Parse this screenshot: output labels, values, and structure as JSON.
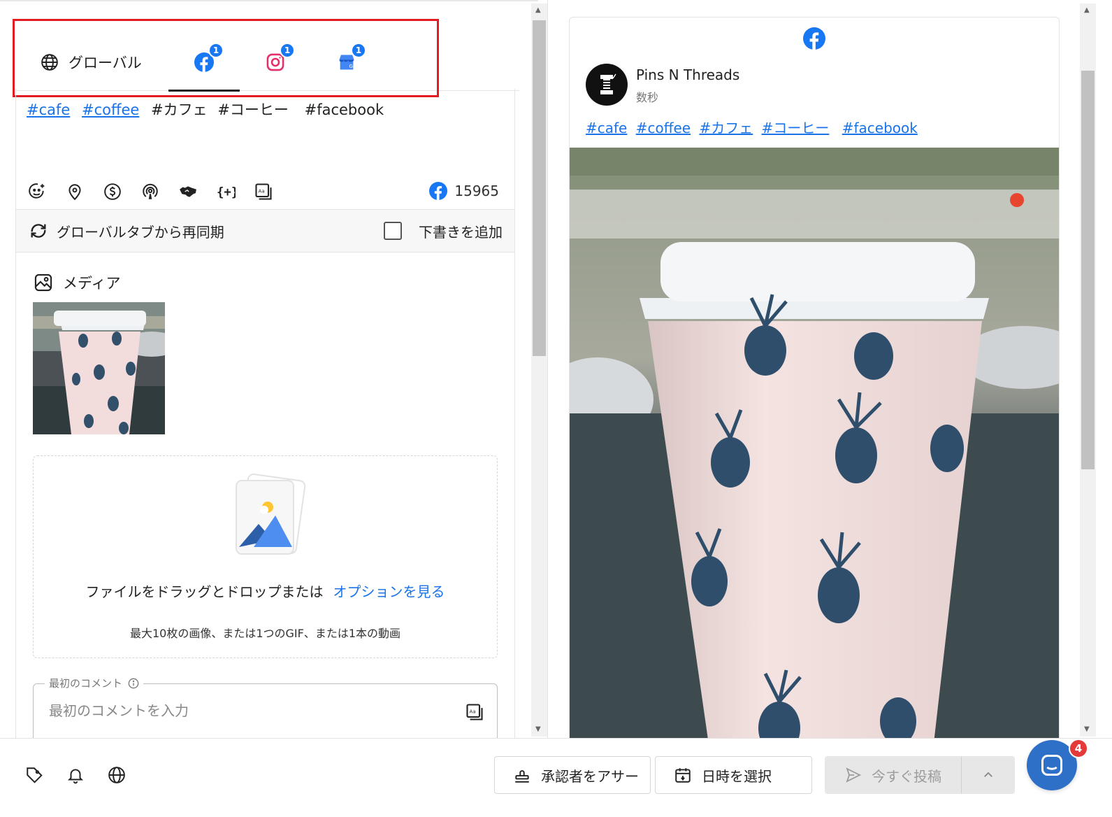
{
  "tabs": {
    "global_label": "グローバル",
    "facebook_badge": "1",
    "instagram_badge": "1",
    "gmb_badge": "1",
    "active": "facebook"
  },
  "editor": {
    "hashtags_linked": [
      "#cafe",
      "#coffee"
    ],
    "text_plain": [
      "#カフェ",
      "#コーヒー",
      "#facebook"
    ],
    "toolbar_icons": [
      "emoji-icon",
      "location-icon",
      "dollar-icon",
      "podcast-icon",
      "handshake-icon",
      "variables-icon",
      "ai-text-icon"
    ],
    "char_count": "15965",
    "resync_label": "グローバルタブから再同期",
    "add_draft_label": "下書きを追加",
    "add_draft_checked": false
  },
  "media": {
    "heading": "メディア",
    "dropzone_text": "ファイルをドラッグとドロップまたは",
    "dropzone_link": "オプションを見る",
    "dropzone_hint": "最大10枚の画像、または1つのGIF、または1本の動画"
  },
  "first_comment": {
    "label": "最初のコメント",
    "placeholder": "最初のコメントを入力"
  },
  "preview": {
    "account_name": "Pins N Threads",
    "timestamp": "数秒",
    "hashtags": [
      "#cafe",
      "#coffee",
      "#カフェ",
      "#コーヒー",
      "#facebook"
    ]
  },
  "bottom": {
    "icons": [
      "tag-icon",
      "bell-icon",
      "globe-icon"
    ],
    "assign_label": "承認者をアサー",
    "date_label": "日時を選択",
    "post_now_label": "今すぐ投稿",
    "chat_badge": "4"
  },
  "colors": {
    "accent": "#1a73e8",
    "facebook": "#1877f2",
    "highlight_box": "#e31b23",
    "chat": "#2e6fc7"
  }
}
